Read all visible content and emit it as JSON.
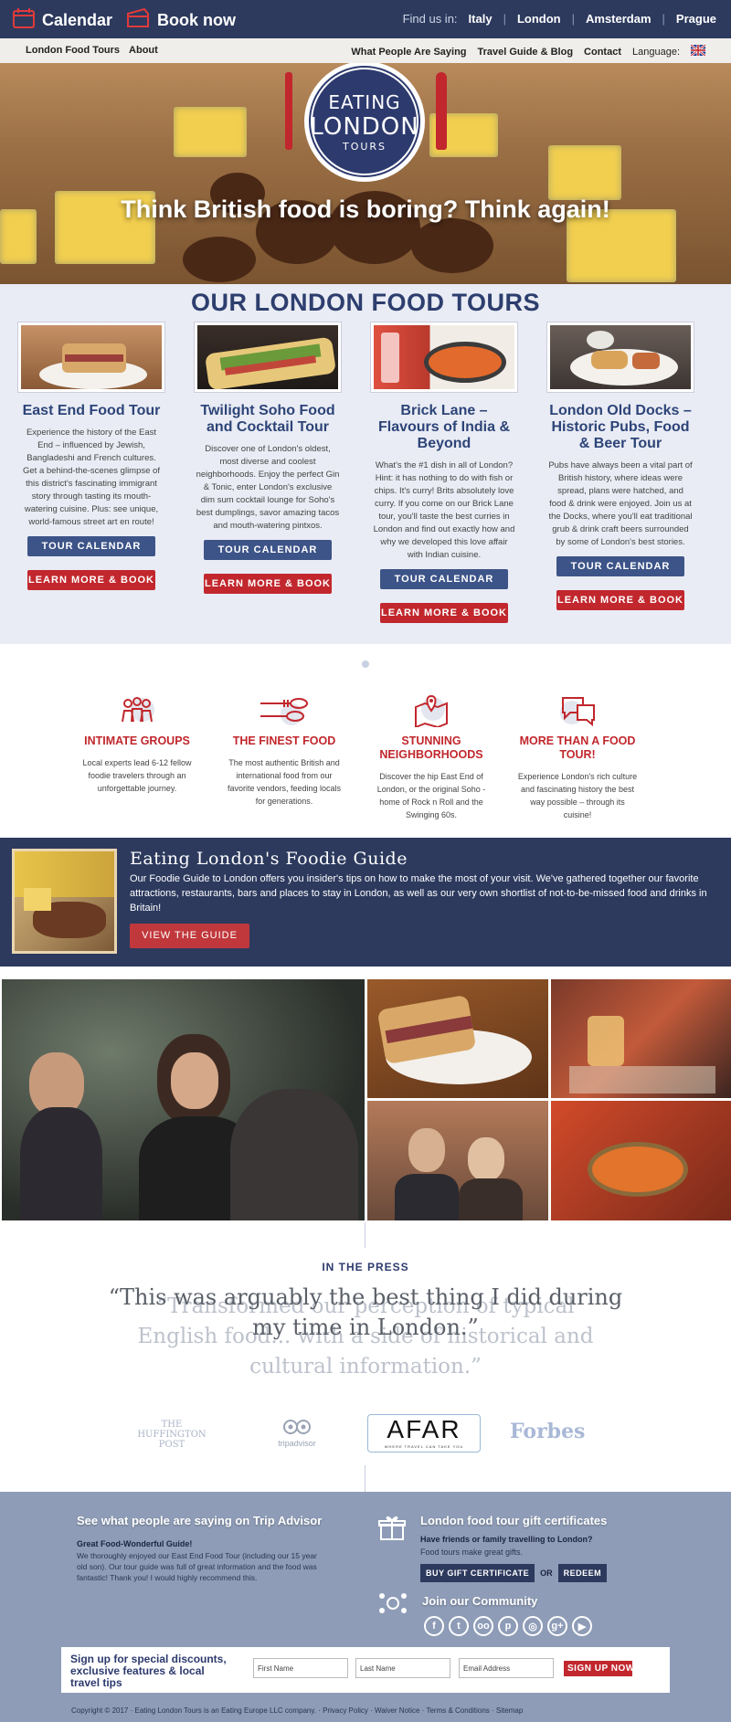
{
  "topbar": {
    "calendar_label": "Calendar",
    "book_label": "Book now",
    "find_label": "Find us in:",
    "cities": [
      "Italy",
      "London",
      "Amsterdam",
      "Prague"
    ]
  },
  "nav": {
    "left": [
      "London Food Tours",
      "About"
    ],
    "right": [
      "What People Are Saying",
      "Travel Guide & Blog",
      "Contact"
    ],
    "language_label": "Language:"
  },
  "hero": {
    "logo_line1": "EATING",
    "logo_line2": "LONDON",
    "logo_line3": "TOURS",
    "headline": "Think British food is boring? Think again!"
  },
  "tours": {
    "title": "OUR LONDON FOOD TOURS",
    "items": [
      {
        "title": "East End Food Tour",
        "text": "Experience the history of the East End – influenced by Jewish, Bangladeshi and French cultures. Get a behind-the-scenes glimpse of this district's fascinating immigrant story through tasting its mouth-watering cuisine. Plus: see unique, world-famous street art en route!",
        "calendar": "TOUR CALENDAR",
        "book": "LEARN MORE & BOOK"
      },
      {
        "title": "Twilight Soho Food and Cocktail Tour",
        "text": "Discover one of London's oldest, most diverse and coolest neighborhoods. Enjoy the perfect Gin & Tonic, enter London's exclusive dim sum cocktail lounge for Soho's best dumplings, savor amazing tacos and mouth-watering pintxos.",
        "calendar": "TOUR CALENDAR",
        "book": "LEARN MORE & BOOK"
      },
      {
        "title": "Brick Lane – Flavours of India & Beyond",
        "text": "What's the #1 dish in all of London? Hint: it has nothing to do with fish or chips. It's curry! Brits absolutely love curry. If you come on our Brick Lane tour, you'll taste the best curries in London and find out exactly how and why we developed this love affair with Indian cuisine.",
        "calendar": "TOUR CALENDAR",
        "book": "LEARN MORE & BOOK"
      },
      {
        "title": "London Old Docks – Historic Pubs, Food & Beer Tour",
        "text": "Pubs have always been a vital part of British history, where ideas were spread, plans were hatched, and food & drink were enjoyed. Join us at the Docks, where you'll eat traditional grub & drink craft beers surrounded by some of London's best stories.",
        "calendar": "TOUR CALENDAR",
        "book": "LEARN MORE & BOOK"
      }
    ]
  },
  "features": [
    {
      "title": "INTIMATE GROUPS",
      "text": "Local experts lead 6-12 fellow foodie travelers through an unforgettable journey.",
      "icon": "people-icon"
    },
    {
      "title": "THE FINEST FOOD",
      "text": "The most authentic British and international food from our favorite vendors, feeding locals for generations.",
      "icon": "fork-spoon-icon"
    },
    {
      "title": "STUNNING NEIGHBORHOODS",
      "text": "Discover the hip East End of London, or the original Soho - home of Rock n Roll and the Swinging 60s.",
      "icon": "map-pin-icon"
    },
    {
      "title": "MORE THAN A FOOD TOUR!",
      "text": "Experience London's rich culture and fascinating history the best way possible – through its cuisine!",
      "icon": "chat-icon"
    }
  ],
  "guide": {
    "title": "Eating London's Foodie Guide",
    "text": "Our Foodie Guide to London offers you insider's tips on how to make the most of your visit. We've gathered together our favorite attractions, restaurants, bars and places to stay in London, as well as our very own shortlist of not-to-be-missed food and drinks in Britain!",
    "button": "VIEW THE GUIDE"
  },
  "press": {
    "heading": "IN THE PRESS",
    "quote_front": "“This was arguably the best thing I did during my time in London.”",
    "quote_back": "“Transformed our perception of typical English food... with a side of historical and cultural information.”",
    "logos": [
      "THE HUFFINGTON POST",
      "tripadvisor",
      "AFAR",
      "WHERE TRAVEL CAN TAKE YOU",
      "Forbes"
    ]
  },
  "footer": {
    "ta_title": "See what people are saying on Trip Advisor",
    "ta_review_title": "Great Food-Wonderful Guide!",
    "ta_review_text": "We thoroughly enjoyed our East End Food Tour (including our 15 year old son). Our tour guide was full of great information and the food was fantastic! Thank you! I would highly recommend this.",
    "gc_title": "London food tour gift certificates",
    "gc_q": "Have friends or family travelling to London?",
    "gc_sub": "Food tours make great gifts.",
    "gc_buy": "BUY GIFT CERTIFICATE",
    "gc_or": "OR",
    "gc_redeem": "REDEEM",
    "community": "Join our Community",
    "social": [
      "f",
      "t",
      "ta",
      "p",
      "ig",
      "g+",
      "yt"
    ],
    "signup_text": "Sign up for special discounts, exclusive features & local travel tips",
    "first_name": "First Name",
    "last_name": "Last Name",
    "email": "Email Address",
    "signup_btn": "SIGN UP NOW",
    "copyright": "Copyright © 2017 · Eating London Tours is an Eating Europe LLC company. · Privacy Policy · Waiver Notice · Terms & Conditions · Sitemap"
  },
  "colors": {
    "navy": "#2d3a5e",
    "red": "#c1272d",
    "title_blue": "#2d4478",
    "footer_bg": "#8e9cb7"
  }
}
